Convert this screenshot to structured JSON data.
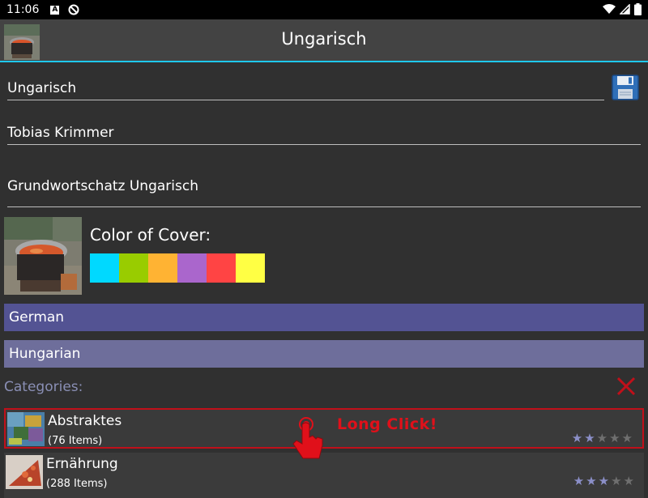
{
  "status_bar": {
    "time": "11:06",
    "icons": [
      "notification-a-icon",
      "do-not-disturb-icon",
      "wifi-icon",
      "signal-icon",
      "battery-icon"
    ]
  },
  "app_bar": {
    "title": "Ungarisch",
    "accent_color": "#1fc8ec"
  },
  "form": {
    "title_value": "Ungarisch",
    "author_value": "Tobias Krimmer",
    "description_value": "Grundwortschatz Ungarisch"
  },
  "cover": {
    "label": "Color of Cover:",
    "colors": [
      "#00d9ff",
      "#99cc00",
      "#ffb333",
      "#aa66cc",
      "#ff4444",
      "#ffff44"
    ]
  },
  "languages": {
    "source": "German",
    "target": "Hungarian",
    "source_color": "#535393",
    "target_color": "#6e6e9b"
  },
  "categories": {
    "label": "Categories:",
    "items": [
      {
        "name": "Abstraktes",
        "count": "(76 Items)",
        "rating": 2
      },
      {
        "name": "Ernährung",
        "count": "(288 Items)",
        "rating": 3
      }
    ]
  },
  "overlay": {
    "text": "Long Click!"
  }
}
